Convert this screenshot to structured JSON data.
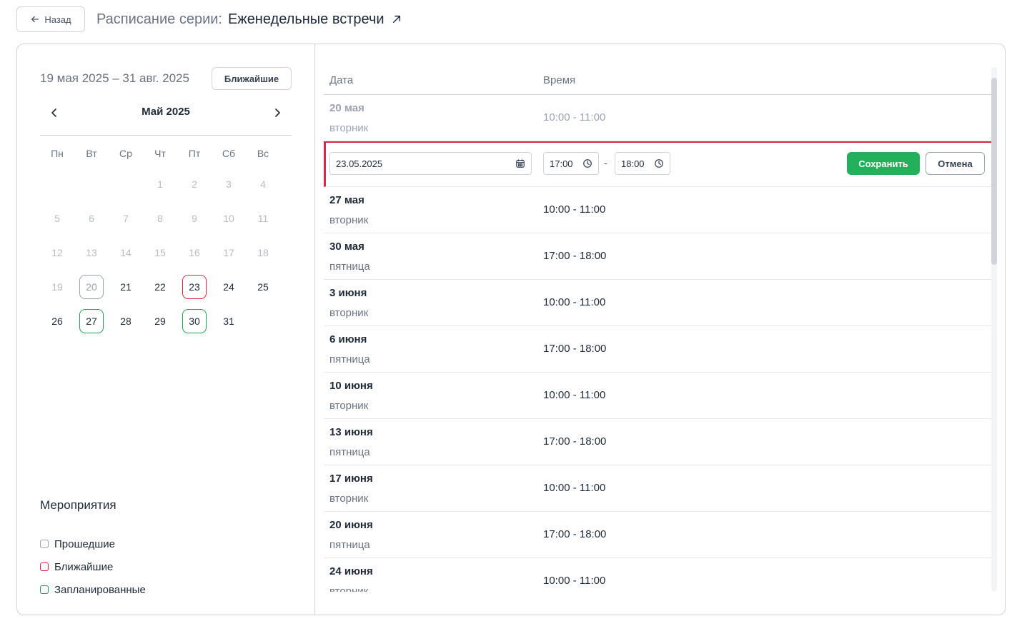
{
  "header": {
    "back_label": "Назад",
    "title_prefix": "Расписание серии:",
    "series_name": "Еженедельные встречи"
  },
  "sidebar": {
    "date_range": "19 мая 2025 – 31 авг. 2025",
    "nearest_button": "Ближайшие",
    "month_label": "Май 2025",
    "weekdays": [
      "Пн",
      "Вт",
      "Ср",
      "Чт",
      "Пт",
      "Сб",
      "Вс"
    ],
    "days": [
      {
        "num": "",
        "state": "empty"
      },
      {
        "num": "",
        "state": "empty"
      },
      {
        "num": "",
        "state": "empty"
      },
      {
        "num": "1",
        "state": "disabled"
      },
      {
        "num": "2",
        "state": "disabled"
      },
      {
        "num": "3",
        "state": "disabled"
      },
      {
        "num": "4",
        "state": "disabled"
      },
      {
        "num": "5",
        "state": "disabled"
      },
      {
        "num": "6",
        "state": "disabled"
      },
      {
        "num": "7",
        "state": "disabled"
      },
      {
        "num": "8",
        "state": "disabled"
      },
      {
        "num": "9",
        "state": "disabled"
      },
      {
        "num": "10",
        "state": "disabled"
      },
      {
        "num": "11",
        "state": "disabled"
      },
      {
        "num": "12",
        "state": "disabled"
      },
      {
        "num": "13",
        "state": "disabled"
      },
      {
        "num": "14",
        "state": "disabled"
      },
      {
        "num": "15",
        "state": "disabled"
      },
      {
        "num": "16",
        "state": "disabled"
      },
      {
        "num": "17",
        "state": "disabled"
      },
      {
        "num": "18",
        "state": "disabled"
      },
      {
        "num": "19",
        "state": "disabled"
      },
      {
        "num": "20",
        "state": "past"
      },
      {
        "num": "21",
        "state": "active"
      },
      {
        "num": "22",
        "state": "active"
      },
      {
        "num": "23",
        "state": "nearest"
      },
      {
        "num": "24",
        "state": "active"
      },
      {
        "num": "25",
        "state": "active"
      },
      {
        "num": "26",
        "state": "active"
      },
      {
        "num": "27",
        "state": "planned"
      },
      {
        "num": "28",
        "state": "active"
      },
      {
        "num": "29",
        "state": "active"
      },
      {
        "num": "30",
        "state": "planned"
      },
      {
        "num": "31",
        "state": "active"
      }
    ],
    "legend_title": "Мероприятия",
    "legend": [
      {
        "label": "Прошедшие",
        "kind": "past"
      },
      {
        "label": "Ближайшие",
        "kind": "nearest"
      },
      {
        "label": "Запланированные",
        "kind": "planned"
      }
    ]
  },
  "schedule": {
    "col_date": "Дата",
    "col_time": "Время",
    "past_row": {
      "date": "20 мая",
      "weekday": "вторник",
      "time": "10:00 - 11:00"
    },
    "edit_row": {
      "date_value": "23.05.2025",
      "start_time": "17:00",
      "end_time": "18:00",
      "separator": "-",
      "save_label": "Сохранить",
      "cancel_label": "Отмена"
    },
    "rows": [
      {
        "date": "27 мая",
        "weekday": "вторник",
        "time": "10:00 - 11:00"
      },
      {
        "date": "30 мая",
        "weekday": "пятница",
        "time": "17:00 - 18:00"
      },
      {
        "date": "3 июня",
        "weekday": "вторник",
        "time": "10:00 - 11:00"
      },
      {
        "date": "6 июня",
        "weekday": "пятница",
        "time": "17:00 - 18:00"
      },
      {
        "date": "10 июня",
        "weekday": "вторник",
        "time": "10:00 - 11:00"
      },
      {
        "date": "13 июня",
        "weekday": "пятница",
        "time": "17:00 - 18:00"
      },
      {
        "date": "17 июня",
        "weekday": "вторник",
        "time": "10:00 - 11:00"
      },
      {
        "date": "20 июня",
        "weekday": "пятница",
        "time": "17:00 - 18:00"
      },
      {
        "date": "24 июня",
        "weekday": "вторник",
        "time": "10:00 - 11:00"
      }
    ]
  },
  "colors": {
    "nearest": "#dc2647",
    "planned": "#22a055",
    "past": "#9ca3af",
    "save": "#22b05a"
  },
  "icons": {
    "back": "arrow-left-icon",
    "external": "arrow-up-right-icon",
    "prev": "chevron-left-icon",
    "next": "chevron-right-icon",
    "calendar": "calendar-icon",
    "clock": "clock-icon"
  }
}
